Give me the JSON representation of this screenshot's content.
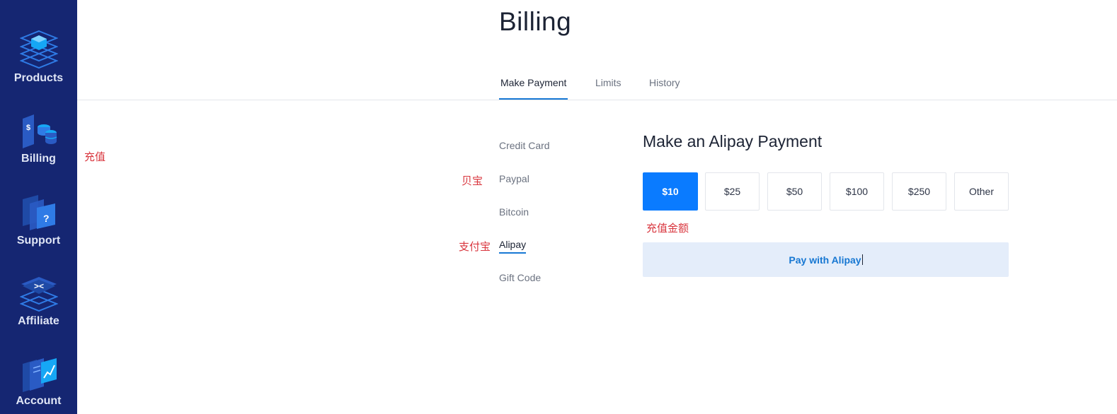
{
  "sidebar": {
    "items": [
      {
        "label": "Products",
        "icon": "products-icon"
      },
      {
        "label": "Billing",
        "icon": "billing-icon"
      },
      {
        "label": "Support",
        "icon": "support-icon"
      },
      {
        "label": "Affiliate",
        "icon": "affiliate-icon"
      },
      {
        "label": "Account",
        "icon": "account-icon"
      }
    ]
  },
  "header": {
    "title": "Billing",
    "tabs": [
      {
        "label": "Make Payment",
        "active": true
      },
      {
        "label": "Limits",
        "active": false
      },
      {
        "label": "History",
        "active": false
      }
    ]
  },
  "annotations": {
    "recharge": "充值",
    "paypal": "贝宝",
    "alipay": "支付宝",
    "amount": "充值金额"
  },
  "methods": [
    {
      "label": "Credit Card",
      "active": false
    },
    {
      "label": "Paypal",
      "active": false
    },
    {
      "label": "Bitcoin",
      "active": false
    },
    {
      "label": "Alipay",
      "active": true
    },
    {
      "label": "Gift Code",
      "active": false
    }
  ],
  "payment": {
    "title": "Make an Alipay Payment",
    "amounts": [
      "$10",
      "$25",
      "$50",
      "$100",
      "$250",
      "Other"
    ],
    "selected_amount": "$10",
    "pay_button": "Pay with Alipay"
  },
  "colors": {
    "sidebar": "#152672",
    "accent": "#0a7bff",
    "annotation": "#d9363e",
    "pay_button_bg": "#e4edfa"
  }
}
